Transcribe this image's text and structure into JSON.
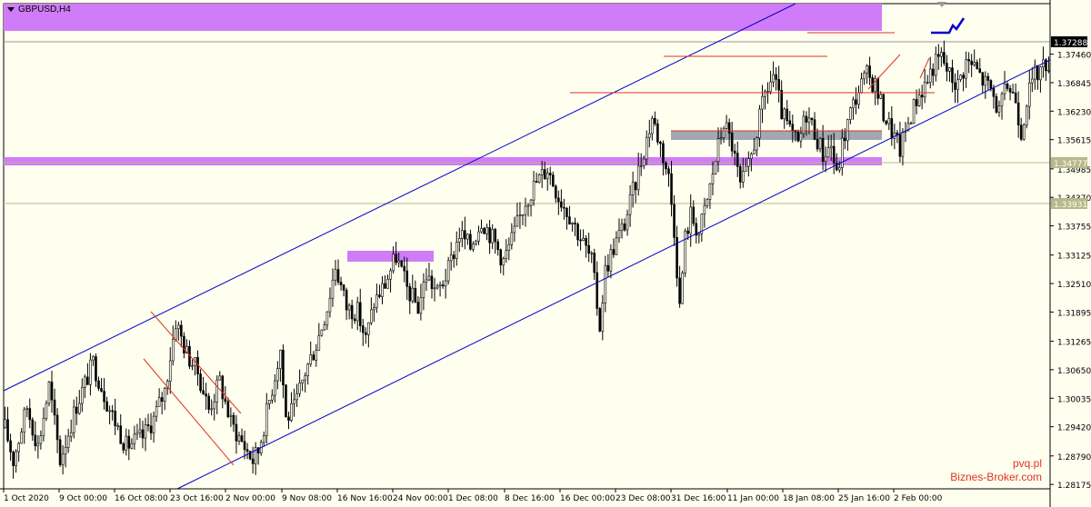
{
  "symbol": "GBPUSD,H4",
  "watermark": {
    "line1": "pvq.pl",
    "line2": "Biznes-Broker.com"
  },
  "colors": {
    "background": "#fffff0",
    "candle": "#000000",
    "channel": "#0000cc",
    "zone": "#d07cf8",
    "support_zone": "#a0a8b4",
    "resistance": "#e0321e",
    "marker_line": "#b8b88a",
    "current_price_bg": "#000000"
  },
  "chart_data": {
    "type": "candlestick",
    "y_ticks": [
      "1.37460",
      "1.36845",
      "1.36230",
      "1.35615",
      "1.34985",
      "1.34370",
      "1.33755",
      "1.33125",
      "1.32510",
      "1.31895",
      "1.31265",
      "1.30650",
      "1.30035",
      "1.29420",
      "1.28790",
      "1.28175"
    ],
    "x_ticks": [
      "1 Oct 2020",
      "9 Oct 00:00",
      "16 Oct 08:00",
      "23 Oct 16:00",
      "2 Nov 00:00",
      "9 Nov 08:00",
      "16 Nov 16:00",
      "24 Nov 00:00",
      "1 Dec 08:00",
      "8 Dec 16:00",
      "16 Dec 00:00",
      "23 Dec 08:00",
      "31 Dec 16:00",
      "11 Jan 00:00",
      "18 Jan 08:00",
      "25 Jan 16:00",
      "2 Feb 00:00"
    ],
    "ylim": [
      1.2808,
      1.3855
    ],
    "price_labels": [
      {
        "value": "1.37288",
        "style": "current"
      },
      {
        "value": "1.34777",
        "style": "marker"
      },
      {
        "value": "1.33931",
        "style": "marker"
      }
    ],
    "path": [
      [
        0,
        1.294
      ],
      [
        3,
        1.287
      ],
      [
        8,
        1.2985
      ],
      [
        12,
        1.29
      ],
      [
        16,
        1.303
      ],
      [
        20,
        1.287
      ],
      [
        26,
        1.299
      ],
      [
        32,
        1.308
      ],
      [
        38,
        1.298
      ],
      [
        44,
        1.29
      ],
      [
        50,
        1.292
      ],
      [
        54,
        1.296
      ],
      [
        58,
        1.302
      ],
      [
        62,
        1.317
      ],
      [
        66,
        1.31
      ],
      [
        70,
        1.306
      ],
      [
        74,
        1.298
      ],
      [
        78,
        1.304
      ],
      [
        82,
        1.295
      ],
      [
        86,
        1.291
      ],
      [
        90,
        1.287
      ],
      [
        92,
        1.289
      ],
      [
        96,
        1.3
      ],
      [
        100,
        1.311
      ],
      [
        102,
        1.296
      ],
      [
        105,
        1.298
      ],
      [
        109,
        1.306
      ],
      [
        113,
        1.312
      ],
      [
        117,
        1.32
      ],
      [
        120,
        1.329
      ],
      [
        124,
        1.32
      ],
      [
        128,
        1.319
      ],
      [
        131,
        1.313
      ],
      [
        134,
        1.321
      ],
      [
        138,
        1.325
      ],
      [
        142,
        1.331
      ],
      [
        146,
        1.324
      ],
      [
        150,
        1.32
      ],
      [
        153,
        1.327
      ],
      [
        157,
        1.323
      ],
      [
        161,
        1.328
      ],
      [
        165,
        1.336
      ],
      [
        169,
        1.333
      ],
      [
        173,
        1.339
      ],
      [
        177,
        1.335
      ],
      [
        181,
        1.33
      ],
      [
        185,
        1.336
      ],
      [
        189,
        1.343
      ],
      [
        193,
        1.347
      ],
      [
        197,
        1.35
      ],
      [
        201,
        1.344
      ],
      [
        205,
        1.34
      ],
      [
        209,
        1.335
      ],
      [
        213,
        1.33
      ],
      [
        216,
        1.316
      ],
      [
        218,
        1.328
      ],
      [
        221,
        1.333
      ],
      [
        225,
        1.338
      ],
      [
        229,
        1.347
      ],
      [
        232,
        1.354
      ],
      [
        235,
        1.361
      ],
      [
        238,
        1.355
      ],
      [
        241,
        1.348
      ],
      [
        243,
        1.337
      ],
      [
        245,
        1.32
      ],
      [
        247,
        1.335
      ],
      [
        249,
        1.34
      ],
      [
        252,
        1.336
      ],
      [
        255,
        1.343
      ],
      [
        258,
        1.352
      ],
      [
        261,
        1.36
      ],
      [
        264,
        1.355
      ],
      [
        267,
        1.346
      ],
      [
        270,
        1.35
      ],
      [
        273,
        1.358
      ],
      [
        276,
        1.366
      ],
      [
        279,
        1.37
      ],
      [
        282,
        1.362
      ],
      [
        285,
        1.358
      ],
      [
        288,
        1.355
      ],
      [
        291,
        1.362
      ],
      [
        294,
        1.358
      ],
      [
        297,
        1.353
      ],
      [
        300,
        1.355
      ],
      [
        302,
        1.348
      ],
      [
        304,
        1.355
      ],
      [
        307,
        1.362
      ],
      [
        310,
        1.367
      ],
      [
        313,
        1.37
      ],
      [
        316,
        1.368
      ],
      [
        319,
        1.362
      ],
      [
        322,
        1.358
      ],
      [
        325,
        1.354
      ],
      [
        328,
        1.36
      ],
      [
        331,
        1.365
      ],
      [
        334,
        1.368
      ],
      [
        337,
        1.372
      ],
      [
        340,
        1.374
      ],
      [
        343,
        1.37
      ],
      [
        346,
        1.368
      ],
      [
        349,
        1.373
      ],
      [
        352,
        1.372
      ],
      [
        355,
        1.369
      ],
      [
        358,
        1.367
      ],
      [
        361,
        1.362
      ],
      [
        364,
        1.368
      ],
      [
        367,
        1.365
      ],
      [
        369,
        1.358
      ],
      [
        371,
        1.365
      ],
      [
        374,
        1.37
      ],
      [
        377,
        1.372
      ],
      [
        380,
        1.374
      ]
    ]
  }
}
